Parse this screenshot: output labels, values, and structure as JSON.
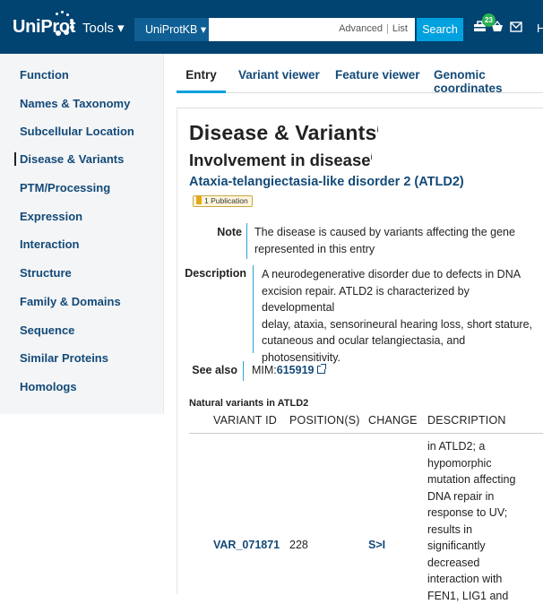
{
  "header": {
    "logo_text": "UniProt",
    "tools_label": "Tools ▾",
    "db_select": "UniProtKB ▾",
    "search_placeholder": "",
    "advanced_label": "Advanced",
    "list_label": "List",
    "search_button": "Search",
    "basket_count": "23",
    "truncated_link": "H",
    "brand_color": "#014371",
    "accent_color": "#00a1df"
  },
  "sidebar": {
    "items": [
      {
        "label": "Function"
      },
      {
        "label": "Names & Taxonomy"
      },
      {
        "label": "Subcellular Location"
      },
      {
        "label": "Disease & Variants"
      },
      {
        "label": "PTM/Processing"
      },
      {
        "label": "Expression"
      },
      {
        "label": "Interaction"
      },
      {
        "label": "Structure"
      },
      {
        "label": "Family & Domains"
      },
      {
        "label": "Sequence"
      },
      {
        "label": "Similar Proteins"
      },
      {
        "label": "Homologs"
      }
    ],
    "active_index": 3
  },
  "tabs": [
    {
      "label": "Entry"
    },
    {
      "label": "Variant viewer"
    },
    {
      "label": "Feature viewer"
    },
    {
      "label": "Genomic coordinates"
    }
  ],
  "section": {
    "title": "Disease & Variants",
    "title_sup": "i",
    "subtitle": "Involvement in disease",
    "subtitle_sup": "i",
    "disease_name": "Ataxia-telangiectasia-like disorder 2 (ATLD2)",
    "publication_chip": "1 Publication",
    "note_label": "Note",
    "note_lines": [
      "The disease is caused by variants affecting the gene",
      "represented in this entry"
    ],
    "description_label": "Description",
    "description_lines": [
      "A neurodegenerative disorder due to defects in DNA",
      "excision repair. ATLD2 is characterized by developmental",
      "delay, ataxia, sensorineural hearing loss, short stature,",
      "cutaneous and ocular telangiectasia, and",
      "photosensitivity."
    ],
    "see_also_label": "See also",
    "mim_prefix": "MIM:",
    "mim_id": "615919"
  },
  "variants": {
    "title": "Natural variants in ATLD2",
    "headers": [
      "VARIANT ID",
      "POSITION(S)",
      "CHANGE",
      "DESCRIPTION"
    ],
    "rows": [
      {
        "id": "VAR_071871",
        "position": "228",
        "change": "S>I",
        "description_lines": [
          "in ATLD2; a",
          "hypomorphic",
          "mutation affecting",
          "DNA repair in",
          "response to UV;",
          "results in",
          "significantly",
          "decreased",
          "interaction with",
          "FEN1, LIG1 and"
        ]
      }
    ]
  }
}
